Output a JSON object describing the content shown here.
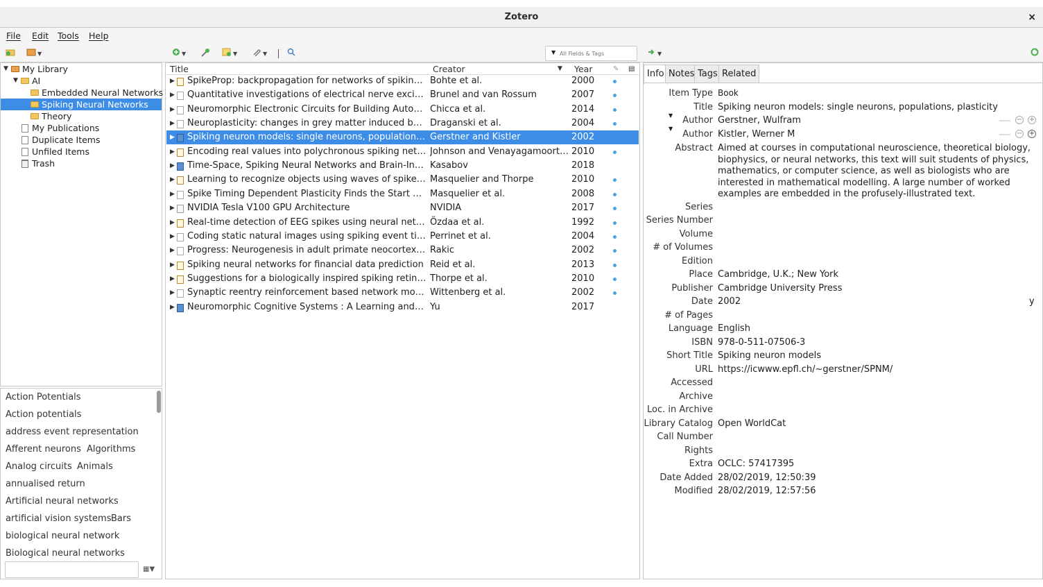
{
  "window": {
    "title": "Zotero",
    "close": "×"
  },
  "menu": [
    "File",
    "Edit",
    "Tools",
    "Help"
  ],
  "toolbar": {
    "search_placeholder": "All Fields & Tags"
  },
  "collections": {
    "my_library": "My Library",
    "ai": "AI",
    "embedded": "Embedded Neural Networks",
    "spiking": "Spiking Neural Networks",
    "theory": "Theory",
    "publications": "My Publications",
    "duplicates": "Duplicate Items",
    "unfiled": "Unfiled Items",
    "trash": "Trash"
  },
  "tags": {
    "t1": "Action Potentials",
    "t2": "Action potentials",
    "t3": "address event representation",
    "t4": "Afferent neurons",
    "t5": "Algorithms",
    "t6": "Analog circuits",
    "t7": "Animals",
    "t8": "annualised return",
    "t9": "Artificial neural networks",
    "t10": "artificial vision systems",
    "t11": "Bars",
    "t12": "biological neural network",
    "t13": "Biological neural networks"
  },
  "columns": {
    "title": "Title",
    "creator": "Creator",
    "year": "Year"
  },
  "items": [
    {
      "title": "SpikeProp: backpropagation for networks of spiking neurons",
      "creator": "Bohte et al.",
      "year": "2000",
      "type": "journal",
      "attach": true
    },
    {
      "title": "Quantitative investigations of electrical nerve excitation treated as polarization",
      "creator": "Brunel and van Rossum",
      "year": "2007",
      "type": "doc",
      "attach": true
    },
    {
      "title": "Neuromorphic Electronic Circuits for Building Autonomous Cognitive Systems",
      "creator": "Chicca et al.",
      "year": "2014",
      "type": "doc",
      "attach": true
    },
    {
      "title": "Neuroplasticity: changes in grey matter induced by training",
      "creator": "Draganski et al.",
      "year": "2004",
      "type": "doc",
      "attach": true
    },
    {
      "title": "Spiking neuron models: single neurons, populations, plasticity",
      "creator": "Gerstner and Kistler",
      "year": "2002",
      "type": "book",
      "attach": false
    },
    {
      "title": "Encoding real values into polychronous spiking networks",
      "creator": "Johnson and Venayagamoorthy",
      "year": "2010",
      "type": "journal",
      "attach": true
    },
    {
      "title": "Time-Space, Spiking Neural Networks and Brain-Inspired Artificial Intelligence",
      "creator": "Kasabov",
      "year": "2018",
      "type": "book",
      "attach": false
    },
    {
      "title": "Learning to recognize objects using waves of spikes and Spike Timing-Dependent Plasticity",
      "creator": "Masquelier and Thorpe",
      "year": "2010",
      "type": "journal",
      "attach": true
    },
    {
      "title": "Spike Timing Dependent Plasticity Finds the Start of Repeating Patterns",
      "creator": "Masquelier et al.",
      "year": "2008",
      "type": "doc",
      "attach": true
    },
    {
      "title": "NVIDIA Tesla V100 GPU Architecture",
      "creator": "NVIDIA",
      "year": "2017",
      "type": "report",
      "attach": true
    },
    {
      "title": "Real-time detection of EEG spikes using neural networks",
      "creator": "Özdaa et al.",
      "year": "1992",
      "type": "journal",
      "attach": true
    },
    {
      "title": "Coding static natural images using spiking event times: do neurons cooperate?",
      "creator": "Perrinet et al.",
      "year": "2004",
      "type": "doc",
      "attach": true
    },
    {
      "title": "Progress: Neurogenesis in adult primate neocortex: an evaluation of the evidence",
      "creator": "Rakic",
      "year": "2002",
      "type": "doc",
      "attach": true
    },
    {
      "title": "Spiking neural networks for financial data prediction",
      "creator": "Reid et al.",
      "year": "2013",
      "type": "journal",
      "attach": true
    },
    {
      "title": "Suggestions for a biologically inspired spiking retina using order-based coding",
      "creator": "Thorpe et al.",
      "year": "2010",
      "type": "journal",
      "attach": true
    },
    {
      "title": "Synaptic reentry reinforcement based network model for long-term memory consolidation",
      "creator": "Wittenberg et al.",
      "year": "2002",
      "type": "doc",
      "attach": true
    },
    {
      "title": "Neuromorphic Cognitive Systems : A Learning and Memory Centered Approach",
      "creator": "Yu",
      "year": "2017",
      "type": "book",
      "attach": false
    }
  ],
  "tabs": [
    "Info",
    "Notes",
    "Tags",
    "Related"
  ],
  "info": {
    "item_type_label": "Item Type",
    "item_type": "Book",
    "title_label": "Title",
    "title": "Spiking neuron models: single neurons, populations, plasticity",
    "author_label": "Author",
    "author1": "Gerstner, Wulfram",
    "author2": "Kistler, Werner M",
    "abstract_label": "Abstract",
    "abstract": "Aimed at courses in computational neuroscience, theoretical biology, biophysics, or neural networks, this text will suit students of physics, mathematics, or computer science, as well as biologists who are interested in mathematical modelling. A large number of worked examples are embedded in the profusely-illustrated text.",
    "series_label": "Series",
    "series_number_label": "Series Number",
    "volume_label": "Volume",
    "num_volumes_label": "# of Volumes",
    "edition_label": "Edition",
    "place_label": "Place",
    "place": "Cambridge, U.K.; New York",
    "publisher_label": "Publisher",
    "publisher": "Cambridge University Press",
    "date_label": "Date",
    "date": "2002",
    "date_flag": "y",
    "pages_label": "# of Pages",
    "language_label": "Language",
    "language": "English",
    "isbn_label": "ISBN",
    "isbn": "978-0-511-07506-3",
    "short_title_label": "Short Title",
    "short_title": "Spiking neuron models",
    "url_label": "URL",
    "url": "https://icwww.epfl.ch/~gerstner/SPNM/",
    "accessed_label": "Accessed",
    "archive_label": "Archive",
    "loc_archive_label": "Loc. in Archive",
    "library_catalog_label": "Library Catalog",
    "library_catalog": "Open WorldCat",
    "call_number_label": "Call Number",
    "rights_label": "Rights",
    "extra_label": "Extra",
    "extra": "OCLC: 57417395",
    "date_added_label": "Date Added",
    "date_added": "28/02/2019, 12:50:39",
    "modified_label": "Modified",
    "modified": "28/02/2019, 12:57:56"
  }
}
